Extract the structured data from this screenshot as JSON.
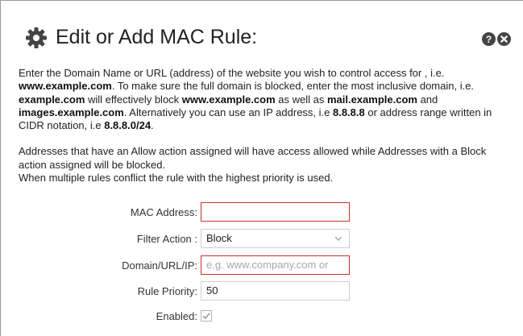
{
  "dialog": {
    "title": "Edit or Add MAC Rule:",
    "icons": {
      "title": "gear-icon",
      "help": "help-icon",
      "close": "close-icon"
    }
  },
  "description": {
    "p1": [
      {
        "t": "Enter the Domain Name or URL (address) of the website you wish to control access for , i.e. ",
        "b": false
      },
      {
        "t": "www.example.com",
        "b": true
      },
      {
        "t": ". To make sure the full domain is blocked, enter the most inclusive domain, i.e. ",
        "b": false
      },
      {
        "t": "example.com",
        "b": true
      },
      {
        "t": " will effectively block ",
        "b": false
      },
      {
        "t": "www.example.com",
        "b": true
      },
      {
        "t": " as well as ",
        "b": false
      },
      {
        "t": "mail.example.com",
        "b": true
      },
      {
        "t": " and ",
        "b": false
      },
      {
        "t": "images.example.com",
        "b": true
      },
      {
        "t": ". Alternatively you can use an IP address, i.e ",
        "b": false
      },
      {
        "t": "8.8.8.8",
        "b": true
      },
      {
        "t": " or address range written in CIDR notation, i.e ",
        "b": false
      },
      {
        "t": "8.8.8.0/24",
        "b": true
      },
      {
        "t": ".",
        "b": false
      }
    ],
    "p2": "Addresses that have an Allow action assigned will have access allowed while Addresses with a Block action assigned will be blocked.",
    "p3": "When multiple rules conflict the rule with the highest priority is used."
  },
  "form": {
    "mac_address": {
      "label": "MAC Address:",
      "value": ""
    },
    "filter_action": {
      "label": "Filter Action :",
      "value": "Block"
    },
    "domain": {
      "label": "Domain/URL/IP:",
      "value": "",
      "placeholder": "e.g. www.company.com or"
    },
    "priority": {
      "label": "Rule Priority:",
      "value": "50"
    },
    "enabled": {
      "label": "Enabled:",
      "checked": true
    }
  },
  "colors": {
    "error_border": "#c9302c",
    "icon_dark": "#444444"
  }
}
